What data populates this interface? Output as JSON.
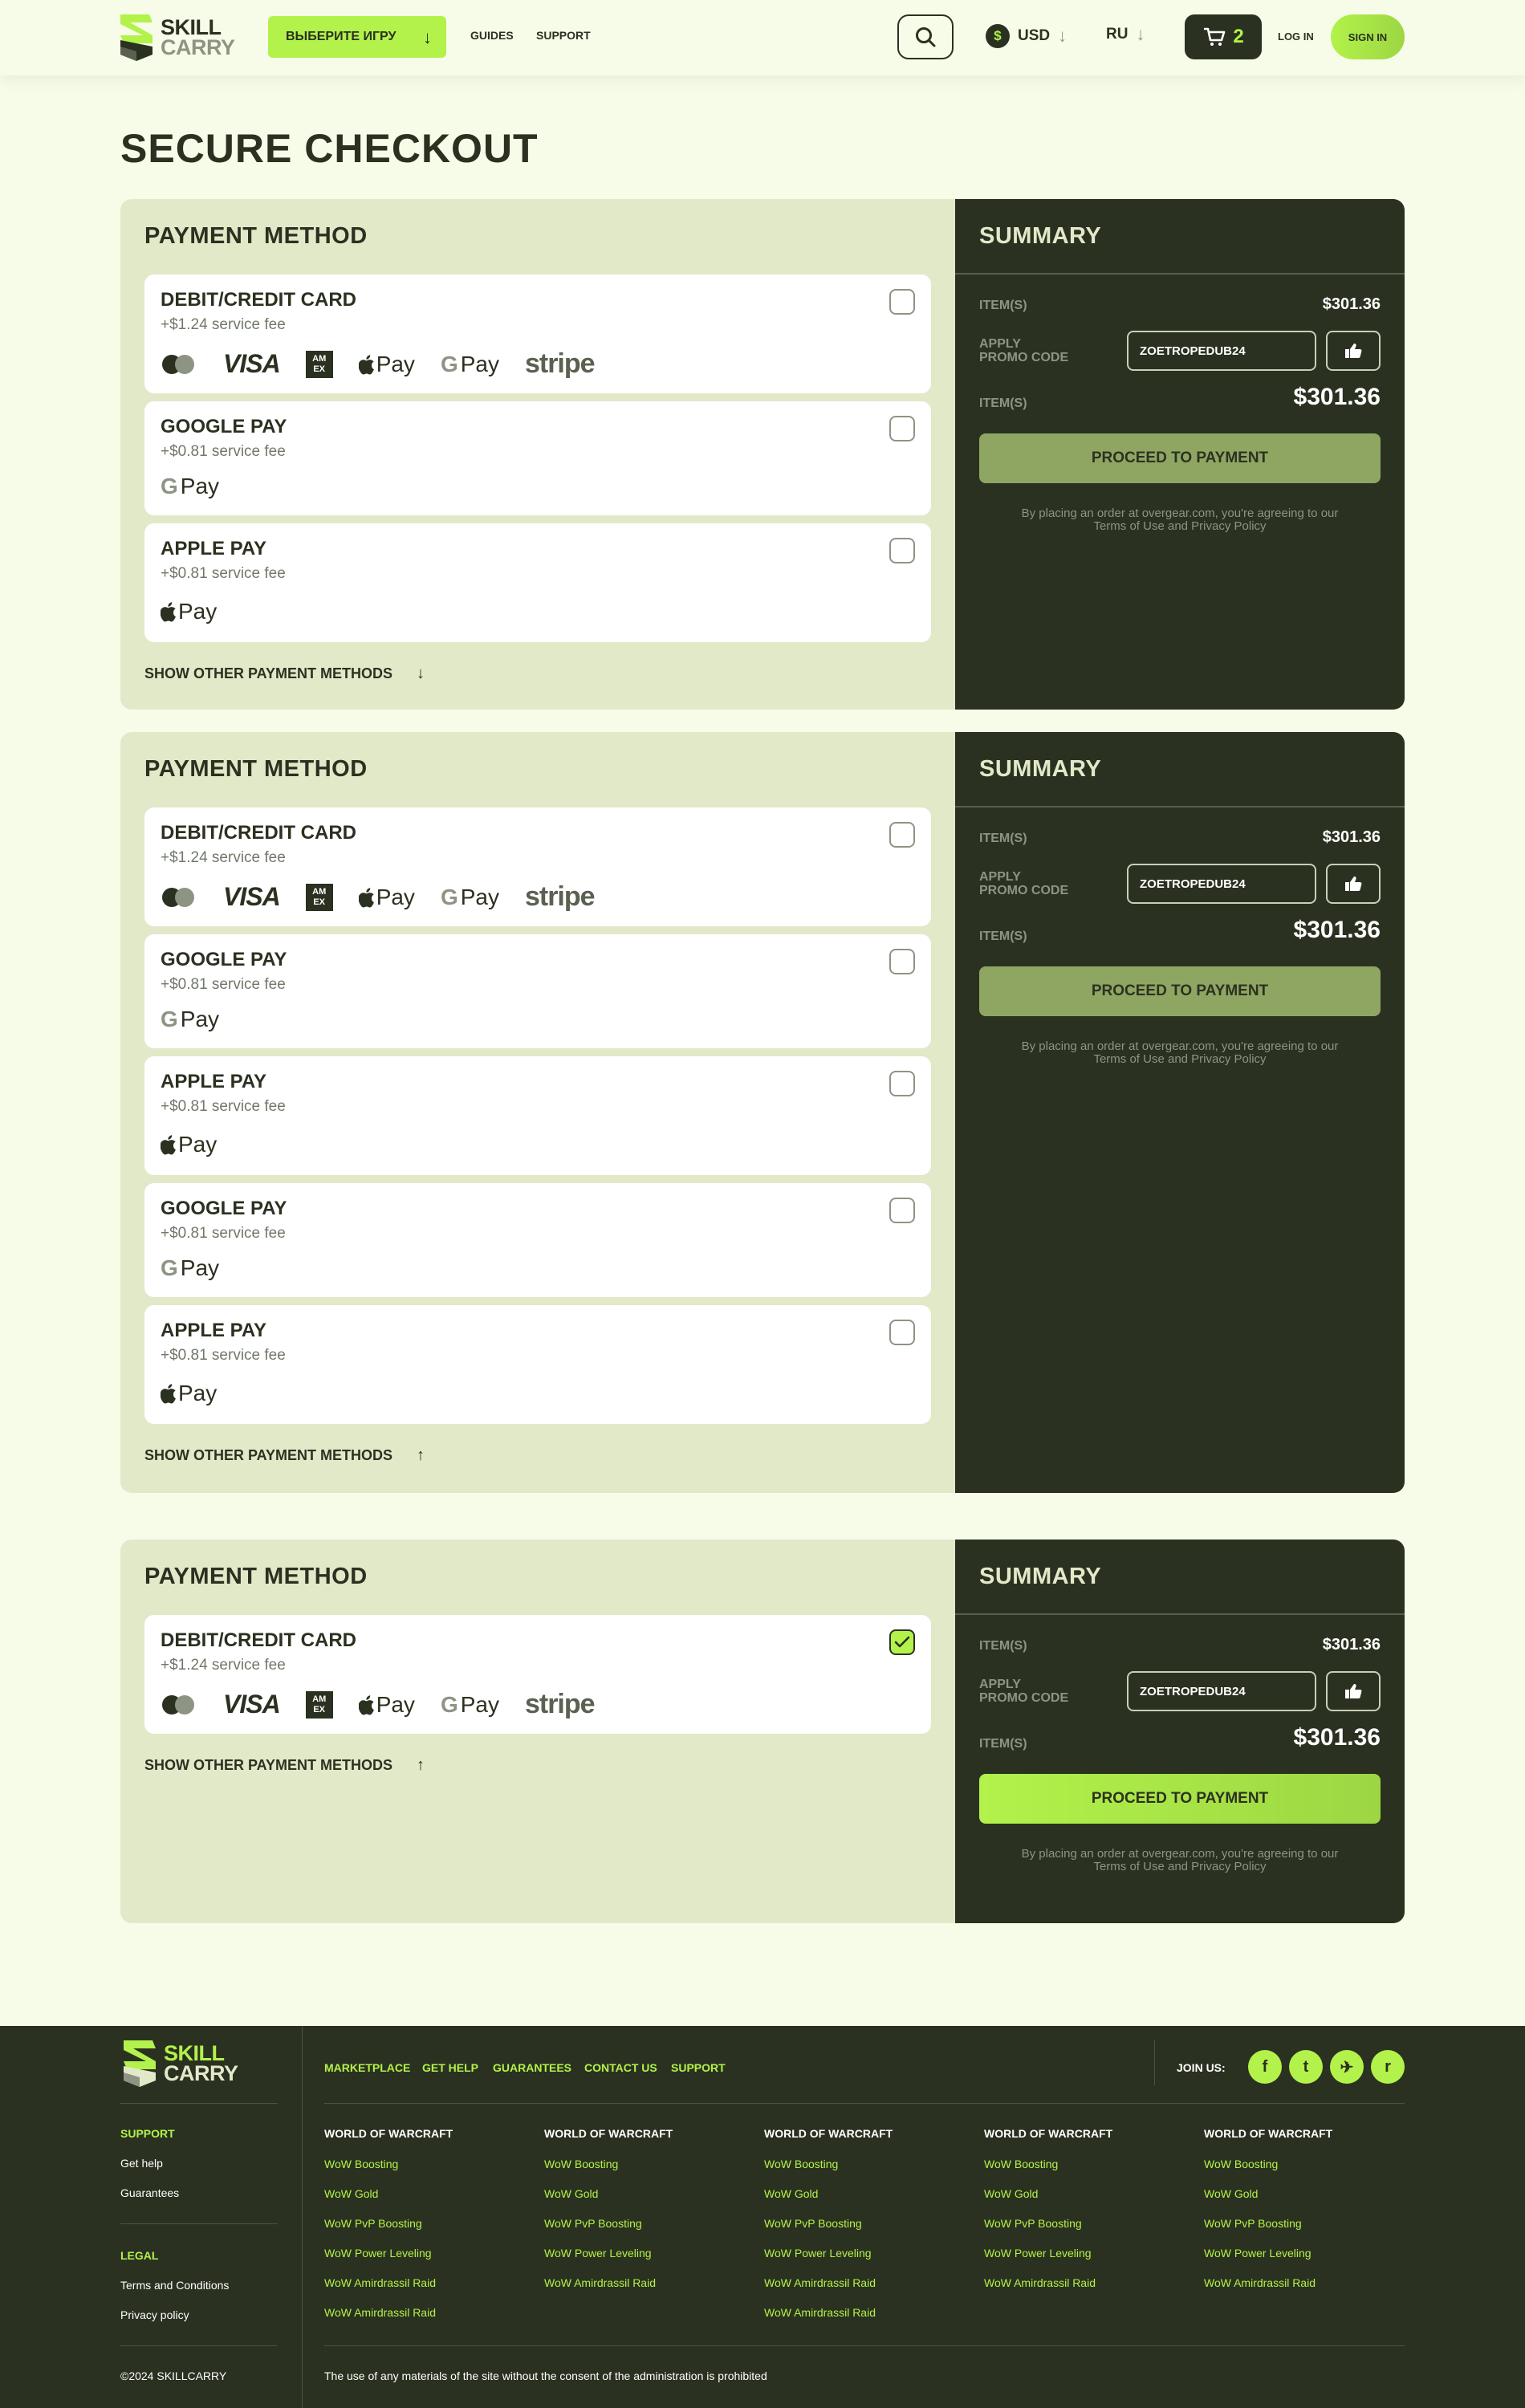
{
  "header": {
    "logo_line1": "SKILL",
    "logo_line2": "CARRY",
    "game_select": "ВЫБЕРИТЕ ИГРУ",
    "nav": [
      "GUIDES",
      "SUPPORT"
    ],
    "currency": "USD",
    "currency_symbol": "$",
    "language": "RU",
    "cart_count": "2",
    "login": "LOG IN",
    "signin": "SIGN IN"
  },
  "page_title": "SECURE CHECKOUT",
  "payment_labels": {
    "section_title": "PAYMENT METHOD",
    "show_other": "SHOW OTHER PAYMENT METHODS"
  },
  "methods": {
    "card": {
      "name": "DEBIT/CREDIT CARD",
      "fee": "+$1.24 service fee"
    },
    "google": {
      "name": "GOOGLE PAY",
      "fee": "+$0.81 service fee",
      "logo": "Pay",
      "logo_g": "G"
    },
    "apple": {
      "name": "APPLE PAY",
      "fee": "+$0.81 service fee",
      "logo": "Pay"
    }
  },
  "card_logos": {
    "visa": "VISA",
    "amex_top": "AM",
    "amex_bottom": "EX",
    "apple_pay": "Pay",
    "google_pay": "Pay",
    "google_g": "G",
    "stripe": "stripe"
  },
  "summary": {
    "title": "SUMMARY",
    "items_label": "ITEM(S)",
    "items_value": "$301.36",
    "promo_label_1": "APPLY",
    "promo_label_2": "PROMO CODE",
    "promo_code": "ZOETROPEDUB24",
    "total_label": "ITEM(S)",
    "total_value": "$301.36",
    "proceed": "PROCEED TO PAYMENT",
    "terms_1": "By placing an order at overgear.com, you're agreeing to our",
    "terms_2": "Terms of Use and Privacy Policy"
  },
  "states": {
    "block1": {
      "selected": "none",
      "expanded": false
    },
    "block2": {
      "selected": "none",
      "expanded": true
    },
    "block3": {
      "selected": "DEBIT/CREDIT CARD",
      "expanded": true
    }
  },
  "colors": {
    "accent": "#b2f24a",
    "dark": "#2b3120",
    "panel": "#e1e9c9",
    "background": "#f7fce9",
    "proceed_disabled": "#8fa663"
  },
  "footer": {
    "logo_line1": "SKILL",
    "logo_line2": "CARRY",
    "nav": [
      "MARKETPLACE",
      "GET HELP",
      "GUARANTEES",
      "CONTACT US",
      "SUPPORT"
    ],
    "join": "JOIN US:",
    "social_icons": [
      "facebook-icon",
      "twitter-icon",
      "telegram-icon",
      "reddit-icon"
    ],
    "social_glyphs": [
      "f",
      "t",
      "✈",
      "r"
    ],
    "support_head": "SUPPORT",
    "support_links": [
      "Get help",
      "Guarantees"
    ],
    "legal_head": "LEGAL",
    "legal_links": [
      "Terms and Conditions",
      "Privacy policy"
    ],
    "columns": [
      {
        "title": "WORLD OF WARCRAFT",
        "items": [
          "WoW Boosting",
          "WoW Gold",
          "WoW PvP Boosting",
          "WoW Power Leveling",
          "WoW Amirdrassil Raid",
          "WoW Amirdrassil Raid"
        ]
      },
      {
        "title": "WORLD OF WARCRAFT",
        "items": [
          "WoW Boosting",
          "WoW Gold",
          "WoW PvP Boosting",
          "WoW Power Leveling",
          "WoW Amirdrassil Raid"
        ]
      },
      {
        "title": "WORLD OF WARCRAFT",
        "items": [
          "WoW Boosting",
          "WoW Gold",
          "WoW PvP Boosting",
          "WoW Power Leveling",
          "WoW Amirdrassil Raid",
          "WoW Amirdrassil Raid"
        ]
      },
      {
        "title": "WORLD OF WARCRAFT",
        "items": [
          "WoW Boosting",
          "WoW Gold",
          "WoW PvP Boosting",
          "WoW Power Leveling",
          "WoW Amirdrassil Raid"
        ]
      },
      {
        "title": "WORLD OF WARCRAFT",
        "items": [
          "WoW Boosting",
          "WoW Gold",
          "WoW PvP Boosting",
          "WoW Power Leveling",
          "WoW Amirdrassil Raid"
        ]
      }
    ],
    "copyright": "©2024 SKILLCARRY",
    "rights": "The use of any materials of the site without the consent of the administration is prohibited"
  }
}
